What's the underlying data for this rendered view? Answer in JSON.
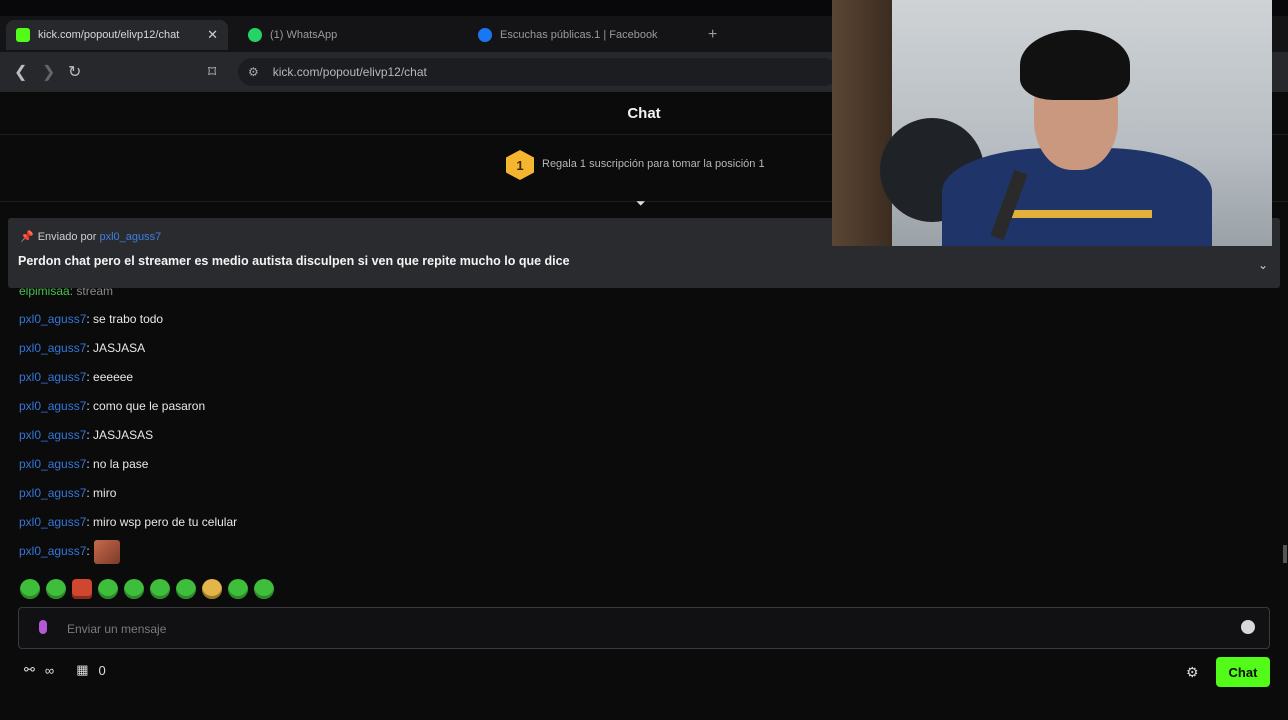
{
  "browser": {
    "tabs": [
      {
        "label": "kick.com/popout/elivp12/chat",
        "active": true,
        "icon": "kick-icon",
        "color": "#53fc18"
      },
      {
        "label": "(1) WhatsApp",
        "active": false,
        "icon": "whatsapp-icon",
        "color": "#25d366"
      },
      {
        "label": "Escuchas públicas.1 | Facebook",
        "active": false,
        "icon": "facebook-icon",
        "color": "#1877f2"
      }
    ],
    "new_tab_symbol": "+",
    "url": "kick.com/popout/elivp12/chat"
  },
  "chat": {
    "title": "Chat",
    "gift_rank": "1",
    "gift_text": "Regala 1 suscripción para tomar la posición 1",
    "pinned": {
      "sent_by_label": "Enviado por",
      "user": "pxl0_aguss7",
      "message": "Perdon chat pero el streamer es medio autista disculpen si ven que repite mucho lo que dice"
    },
    "partial_line": {
      "user": "elpimisaa",
      "text": ": stream"
    },
    "messages": [
      {
        "user": "pxl0_aguss7",
        "text": ": se trabo todo"
      },
      {
        "user": "pxl0_aguss7",
        "text": ": JASJASA"
      },
      {
        "user": "pxl0_aguss7",
        "text": ": eeeeee"
      },
      {
        "user": "pxl0_aguss7",
        "text": ": como que le pasaron"
      },
      {
        "user": "pxl0_aguss7",
        "text": ": JASJASAS"
      },
      {
        "user": "pxl0_aguss7",
        "text": ": no la pase"
      },
      {
        "user": "pxl0_aguss7",
        "text": ": miro"
      },
      {
        "user": "pxl0_aguss7",
        "text": ": miro wsp pero de tu celular"
      },
      {
        "user": "pxl0_aguss7",
        "text": ":"
      }
    ],
    "input_placeholder": "Enviar un mensaje",
    "footer_count": "0",
    "chat_button": "Chat"
  },
  "colors": {
    "accent": "#53fc18",
    "username": "#3576d8",
    "badge": "#f5b531"
  }
}
